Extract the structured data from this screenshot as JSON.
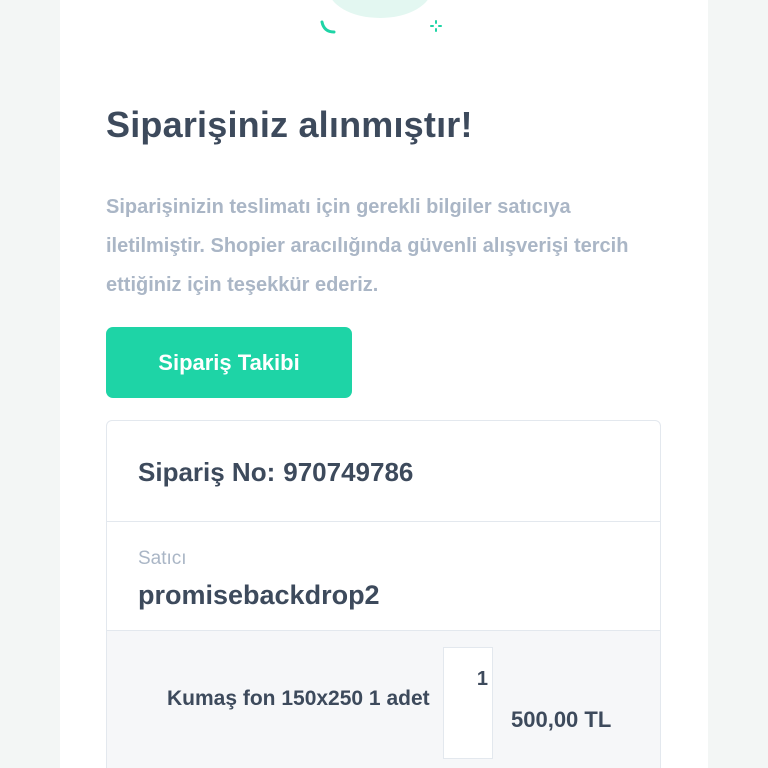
{
  "header": {
    "title": "Siparişiniz alınmıştır!",
    "description": "Siparişinizin teslimatı için gerekli bilgiler satıcıya iletilmiştir. Shopier aracılığında güvenli alışverişi tercih ettiğiniz için teşekkür ederiz."
  },
  "actions": {
    "track_label": "Sipariş Takibi"
  },
  "order": {
    "number_label": "Sipariş No:",
    "number": "970749786",
    "seller_label": "Satıcı",
    "seller_name": "promisebackdrop2",
    "items": [
      {
        "name": "Kumaş fon 150x250 1 adet",
        "quantity": "1",
        "price": "500,00 TL"
      }
    ]
  },
  "colors": {
    "accent": "#1ed4a6",
    "heading": "#3d4a5c",
    "muted": "#aab6c6"
  },
  "icons": {
    "illustration": "success-illustration-icon"
  }
}
